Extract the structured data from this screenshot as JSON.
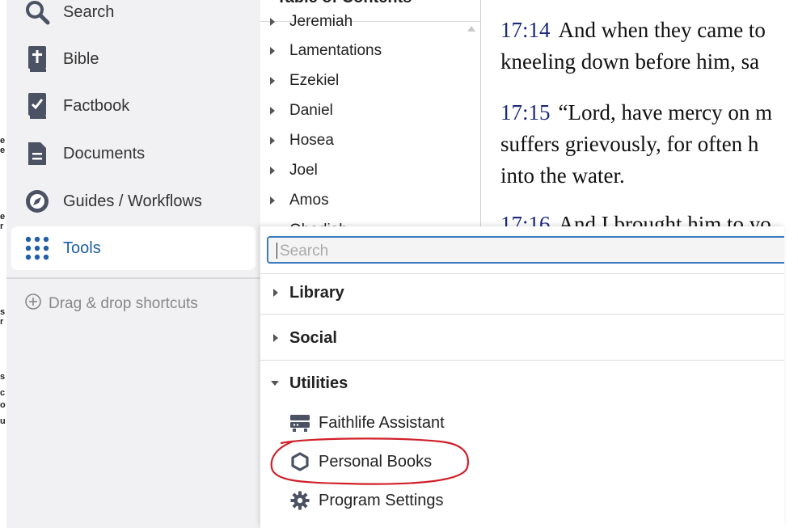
{
  "sidebar": {
    "items": [
      {
        "label": "Search",
        "icon": "search-icon"
      },
      {
        "label": "Bible",
        "icon": "bible-icon"
      },
      {
        "label": "Factbook",
        "icon": "factbook-icon"
      },
      {
        "label": "Documents",
        "icon": "documents-icon"
      },
      {
        "label": "Guides / Workflows",
        "icon": "guides-icon"
      },
      {
        "label": "Tools",
        "icon": "grid-dots-icon",
        "active": true
      }
    ],
    "dragdrop_label": "Drag & drop shortcuts"
  },
  "toc": {
    "title": "Table of Contents",
    "items": [
      "Jeremiah",
      "Lamentations",
      "Ezekiel",
      "Daniel",
      "Hosea",
      "Joel",
      "Amos",
      "Obadiah"
    ]
  },
  "reader": {
    "verses": [
      {
        "num": "17:14",
        "lines": [
          "And when they came to",
          "kneeling down before him, sa"
        ]
      },
      {
        "num": "17:15",
        "lines": [
          "“Lord, have mercy on m",
          "suffers grievously, for often h",
          "into the water."
        ]
      },
      {
        "num": "17:16",
        "lines": [
          "And I brought him to yo"
        ]
      }
    ]
  },
  "tools": {
    "search_placeholder": "Search",
    "sections": [
      {
        "label": "Library",
        "expanded": false
      },
      {
        "label": "Social",
        "expanded": false
      },
      {
        "label": "Utilities",
        "expanded": true
      }
    ],
    "utilities": [
      {
        "label": "Faithlife Assistant",
        "icon": "assistant-icon"
      },
      {
        "label": "Personal Books",
        "icon": "hexagon-icon"
      },
      {
        "label": "Program Settings",
        "icon": "gear-icon"
      }
    ]
  },
  "colors": {
    "accent": "#1f5fa6",
    "verse_number": "#1a2a7a",
    "annotation": "#d0202a",
    "icon": "#4a5263"
  }
}
